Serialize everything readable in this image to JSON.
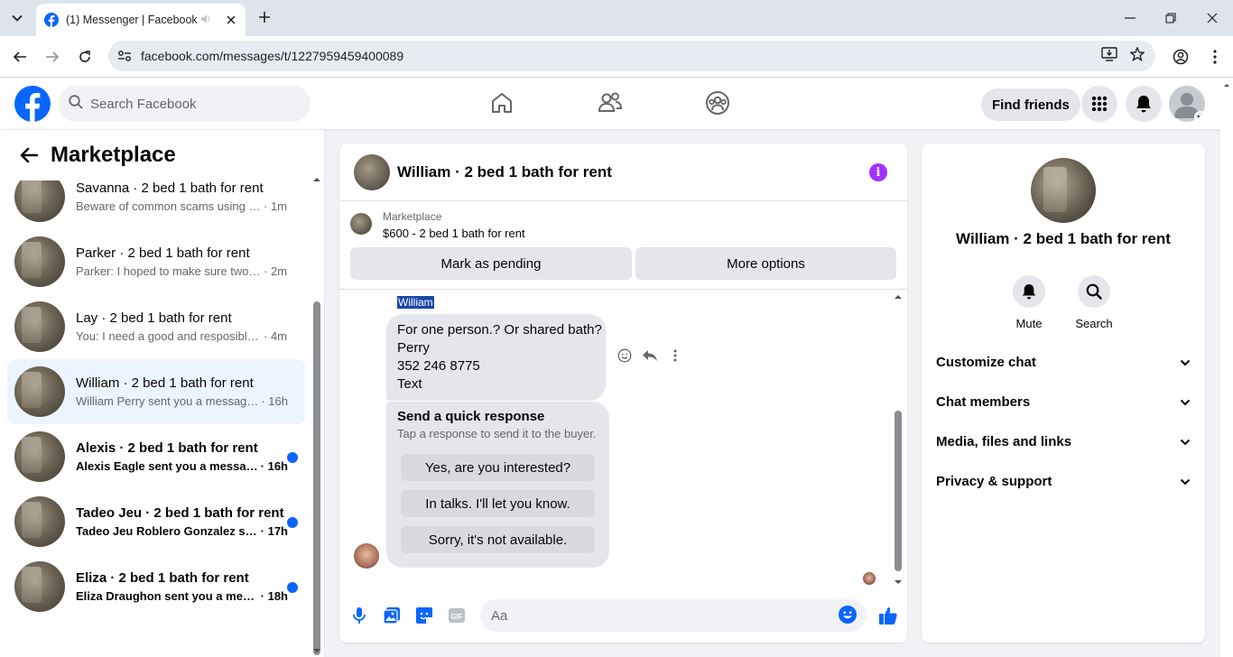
{
  "browser": {
    "tab_title": "(1) Messenger | Facebook",
    "url": "facebook.com/messages/t/1227959459400089"
  },
  "facebook": {
    "search_placeholder": "Search Facebook",
    "find_friends": "Find friends",
    "brand_color": "#0866ff"
  },
  "sidebar": {
    "title": "Marketplace",
    "conversations": [
      {
        "name": "Savanna · 2 bed 1 bath for rent",
        "preview": "Beware of common scams using p...",
        "time": "· 1m",
        "unread": false,
        "active": false
      },
      {
        "name": "Parker · 2 bed 1 bath for rent",
        "preview": "Parker: I hoped to make sure two s...",
        "time": "· 2m",
        "unread": false,
        "active": false
      },
      {
        "name": "Lay · 2 bed 1 bath for rent",
        "preview": "You: I need a good and resposible ...",
        "time": "· 4m",
        "unread": false,
        "active": false
      },
      {
        "name": "William · 2 bed 1 bath for rent",
        "preview": "William Perry sent you a message ...",
        "time": "· 16h",
        "unread": false,
        "active": true
      },
      {
        "name": "Alexis · 2 bed 1 bath for rent",
        "preview": "Alexis Eagle sent you a messag...",
        "time": "· 16h",
        "unread": true,
        "active": false
      },
      {
        "name": "Tadeo Jeu · 2 bed 1 bath for rent",
        "preview": "Tadeo Jeu Roblero Gonzalez se...",
        "time": "· 17h",
        "unread": true,
        "active": false
      },
      {
        "name": "Eliza · 2 bed 1 bath for rent",
        "preview": "Eliza Draughon sent you a mes...",
        "time": "· 18h",
        "unread": true,
        "active": false
      }
    ]
  },
  "chat": {
    "title": "William · 2 bed 1 bath for rent",
    "listing_source": "Marketplace",
    "listing_title": "$600 - 2 bed 1 bath for rent",
    "mark_pending": "Mark as pending",
    "more_options": "More options",
    "sender_label": "William",
    "message_lines": [
      "For one person.? Or shared bath?",
      "Perry",
      "352 246 8775",
      "Text"
    ],
    "quick_response_title": "Send a quick response",
    "quick_response_subtitle": "Tap a response to send it to the buyer.",
    "quick_responses": [
      "Yes, are you interested?",
      "In talks. I'll let you know.",
      "Sorry, it's not available."
    ],
    "input_placeholder": "Aa",
    "accent_color": "#a033ff"
  },
  "info_panel": {
    "name": "William · 2 bed 1 bath for rent",
    "mute": "Mute",
    "search": "Search",
    "sections": [
      "Customize chat",
      "Chat members",
      "Media, files and links",
      "Privacy & support"
    ]
  }
}
